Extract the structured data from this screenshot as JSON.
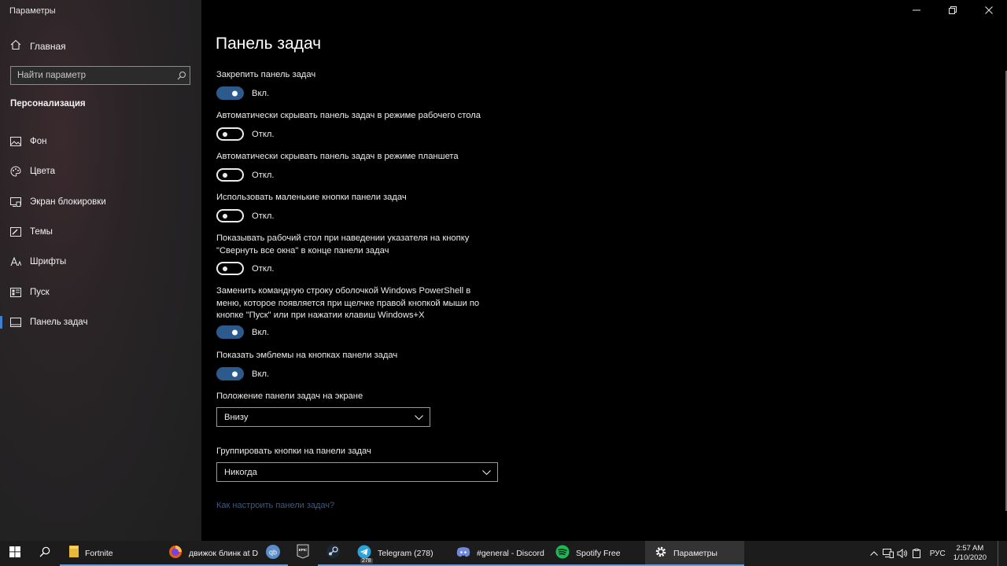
{
  "app": {
    "title": "Параметры"
  },
  "sidebar": {
    "home_label": "Главная",
    "search_placeholder": "Найти параметр",
    "section_title": "Персонализация",
    "items": [
      {
        "label": "Фон",
        "icon": "picture-icon"
      },
      {
        "label": "Цвета",
        "icon": "palette-icon"
      },
      {
        "label": "Экран блокировки",
        "icon": "lock-screen-icon"
      },
      {
        "label": "Темы",
        "icon": "brush-icon"
      },
      {
        "label": "Шрифты",
        "icon": "font-icon"
      },
      {
        "label": "Пуск",
        "icon": "start-icon"
      },
      {
        "label": "Панель задач",
        "icon": "taskbar-icon",
        "active": true
      }
    ]
  },
  "main": {
    "title": "Панель задач",
    "settings": [
      {
        "label": "Закрепить панель задач",
        "state": "Вкл.",
        "on": true
      },
      {
        "label": "Автоматически скрывать панель задач в режиме рабочего стола",
        "state": "Откл.",
        "on": false
      },
      {
        "label": "Автоматически скрывать панель задач в режиме планшета",
        "state": "Откл.",
        "on": false
      },
      {
        "label": "Использовать маленькие кнопки панели задач",
        "state": "Откл.",
        "on": false
      },
      {
        "label": "Показывать рабочий стол при наведении указателя на кнопку \"Свернуть все окна\" в конце панели задач",
        "state": "Откл.",
        "on": false
      },
      {
        "label": "Заменить командную строку оболочкой Windows PowerShell в меню, которое появляется при щелчке правой кнопкой мыши по кнопке \"Пуск\" или при нажатии клавиш Windows+X",
        "state": "Вкл.",
        "on": true
      },
      {
        "label": "Показать эмблемы на кнопках панели задач",
        "state": "Вкл.",
        "on": true
      }
    ],
    "position_label": "Положение панели задач на экране",
    "position_value": "Внизу",
    "group_label": "Группировать кнопки на панели задач",
    "group_value": "Никогда",
    "help_link": "Как настроить панели задач?"
  },
  "taskbar": {
    "apps": [
      {
        "label": "Fortnite",
        "icon": "folder-icon"
      },
      {
        "label": "движок блинк at D...",
        "icon": "firefox-icon"
      },
      {
        "label": "",
        "icon": "qbittorrent-icon"
      },
      {
        "label": "",
        "icon": "epic-games-icon"
      },
      {
        "label": "",
        "icon": "steam-icon"
      },
      {
        "label": "Telegram (278)",
        "icon": "telegram-icon",
        "badge": "278"
      },
      {
        "label": "#general - Discord",
        "icon": "discord-icon"
      },
      {
        "label": "Spotify Free",
        "icon": "spotify-icon"
      },
      {
        "label": "Параметры",
        "icon": "settings-icon",
        "active": true
      }
    ],
    "language": "РУС",
    "time": "2:57 AM",
    "date": "1/10/2020"
  },
  "colors": {
    "accent": "#2d5a8c",
    "link": "#3c5a80",
    "sidebar_bg": "#232223",
    "taskbar_bg": "#1c1c1c"
  }
}
